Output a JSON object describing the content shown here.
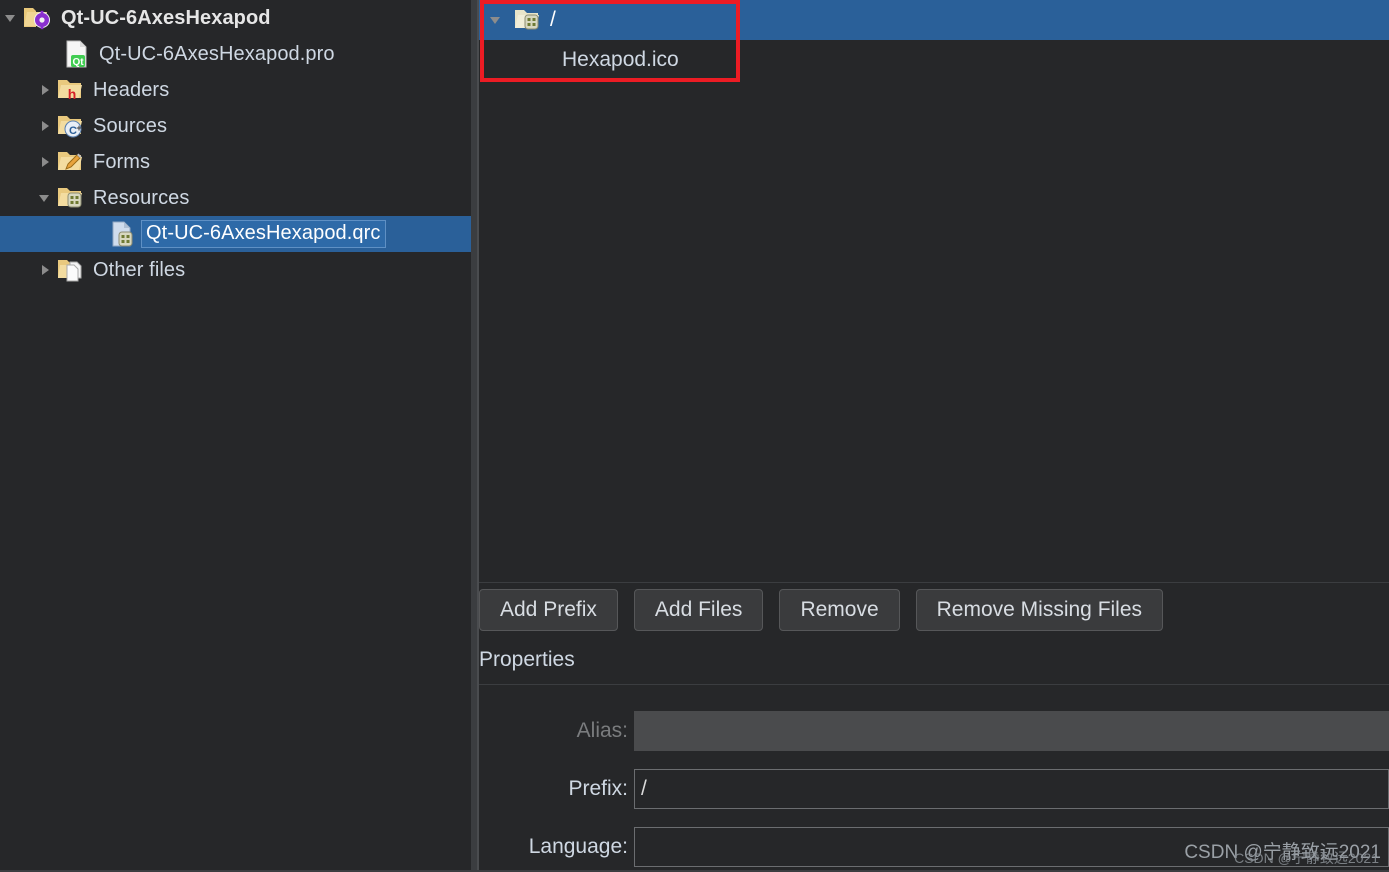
{
  "colors": {
    "background": "#262729",
    "selection_blue": "#2a6099",
    "highlight_red": "#ec1c24",
    "text": "#cfd8e3",
    "disabled_text": "#7a7c7e",
    "button_face": "#3a3b3d",
    "field_border": "#6b6d70",
    "splitter": "#3b3d40"
  },
  "project_tree": {
    "items": [
      {
        "label": "Qt-UC-6AxesHexapod",
        "icon": "folder-project-icon",
        "twisty": "expanded",
        "indent": 0,
        "selected": false,
        "bold": true
      },
      {
        "label": "Qt-UC-6AxesHexapod.pro",
        "icon": "qt-pro-file-icon",
        "twisty": "none",
        "indent": 1,
        "selected": false,
        "bold": false
      },
      {
        "label": "Headers",
        "icon": "folder-headers-icon",
        "twisty": "collapsed",
        "indent": 1,
        "selected": false,
        "bold": false
      },
      {
        "label": "Sources",
        "icon": "folder-sources-icon",
        "twisty": "collapsed",
        "indent": 1,
        "selected": false,
        "bold": false
      },
      {
        "label": "Forms",
        "icon": "folder-forms-icon",
        "twisty": "collapsed",
        "indent": 1,
        "selected": false,
        "bold": false
      },
      {
        "label": "Resources",
        "icon": "folder-resource-icon",
        "twisty": "expanded",
        "indent": 1,
        "selected": false,
        "bold": false
      },
      {
        "label": "Qt-UC-6AxesHexapod.qrc",
        "icon": "qrc-file-icon",
        "twisty": "none",
        "indent": 2,
        "selected": true,
        "bold": false
      },
      {
        "label": "Other files",
        "icon": "folder-other-icon",
        "twisty": "collapsed",
        "indent": 1,
        "selected": false,
        "bold": false
      }
    ]
  },
  "resource_tree": {
    "items": [
      {
        "label": "/",
        "icon": "folder-resource-icon",
        "twisty": "expanded",
        "indent": 0,
        "selected": true
      },
      {
        "label": "Hexapod.ico",
        "icon": "none",
        "twisty": "none",
        "indent": 1,
        "selected": false
      }
    ]
  },
  "buttons": {
    "add_prefix": "Add Prefix",
    "add_files": "Add Files",
    "remove": "Remove",
    "remove_missing_files": "Remove Missing Files"
  },
  "properties": {
    "title": "Properties",
    "alias": {
      "label": "Alias:",
      "value": "",
      "placeholder": "",
      "enabled": false
    },
    "prefix": {
      "label": "Prefix:",
      "value": "/",
      "placeholder": "",
      "enabled": true
    },
    "language": {
      "label": "Language:",
      "value": "",
      "placeholder": "",
      "enabled": true
    }
  },
  "watermark": {
    "text": "CSDN @宁静致远2021",
    "ghost": "CSDN @宁静致远2021"
  }
}
